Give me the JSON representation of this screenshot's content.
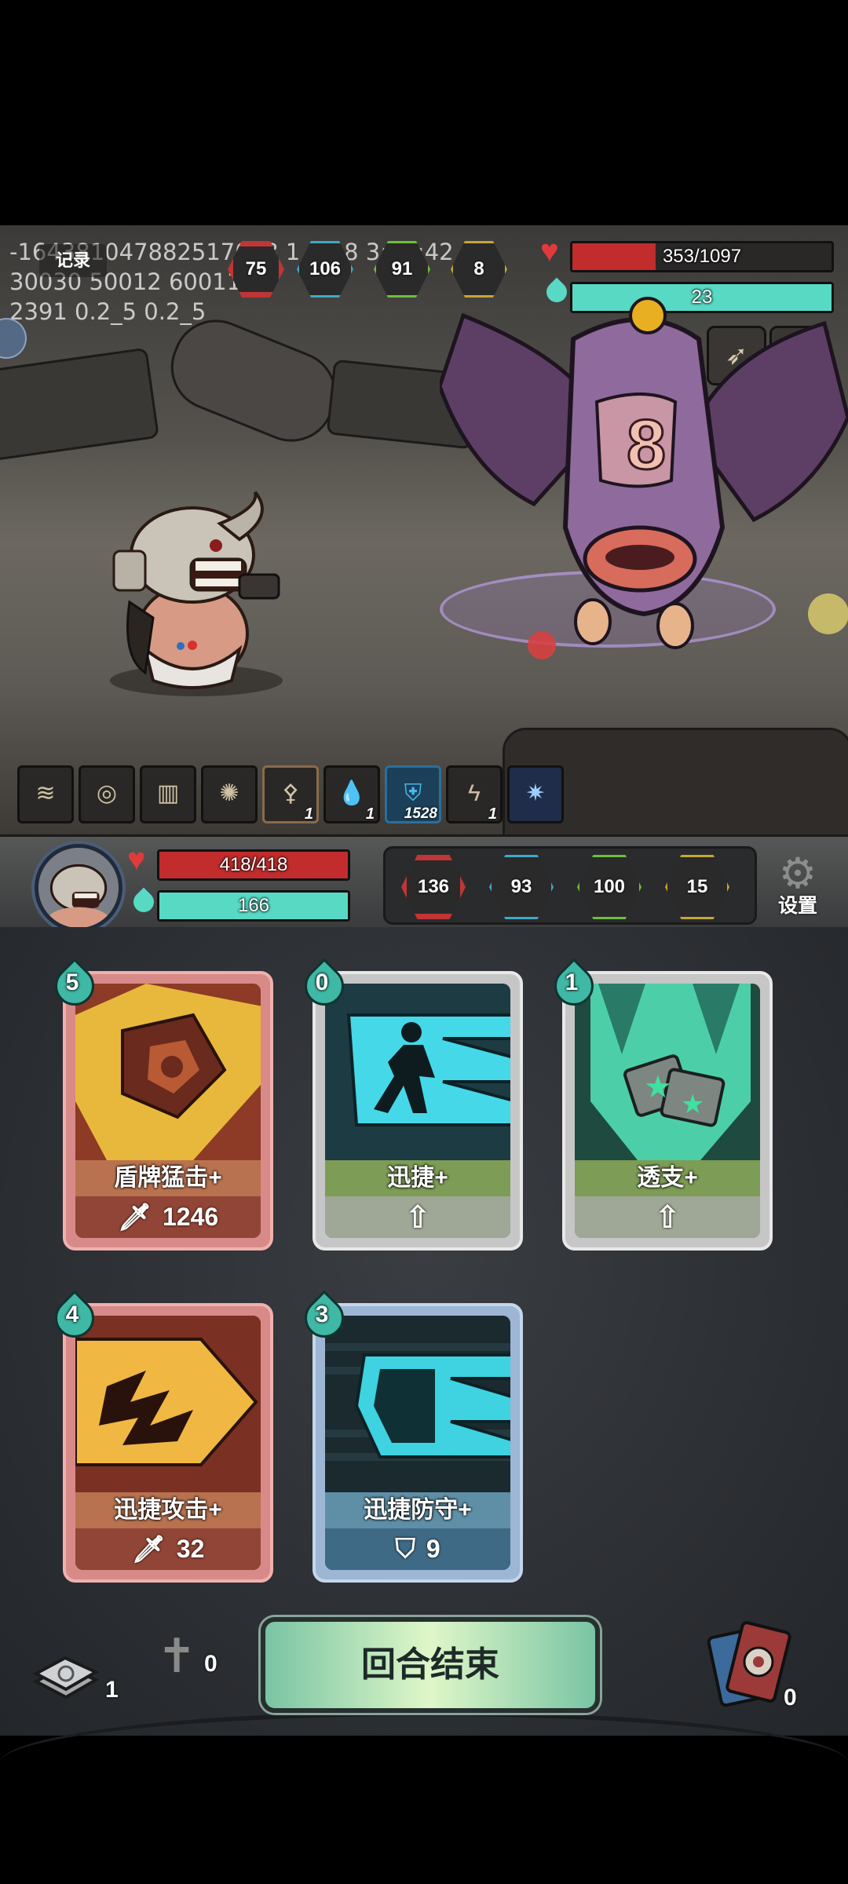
{
  "debug": {
    "line1": "-164381047882517078 1 9/18 3:29:42",
    "line2": "30030 50012 60011",
    "line3": "2391 0.2_5 0.2_5",
    "log_button": "记录"
  },
  "enemy": {
    "stats": [
      {
        "icon": "strength-icon",
        "value": "75",
        "color": "#c03535"
      },
      {
        "icon": "wisdom-icon",
        "value": "106",
        "color": "#3fa9c6"
      },
      {
        "icon": "defense-icon",
        "value": "91",
        "color": "#6cbf3a"
      },
      {
        "icon": "agility-icon",
        "value": "8",
        "color": "#c6a632"
      }
    ],
    "hp": {
      "text": "353/1097",
      "current": 353,
      "max": 1097,
      "color": "#c22c2c"
    },
    "energy": {
      "text": "23",
      "fraction": 1.0,
      "color": "#57d9c4"
    },
    "relics": [
      {
        "icon": "horn-icon"
      },
      {
        "icon": "planet-ring-icon"
      }
    ]
  },
  "statuses": [
    {
      "icon": "mummy-wrap-icon",
      "count": ""
    },
    {
      "icon": "shell-icon",
      "count": ""
    },
    {
      "icon": "wrist-guard-icon",
      "count": ""
    },
    {
      "icon": "compass-icon",
      "count": ""
    },
    {
      "icon": "bone-icon",
      "count": "1"
    },
    {
      "icon": "droplets-icon",
      "count": "1"
    },
    {
      "icon": "block-shield-icon",
      "count": "1528"
    },
    {
      "icon": "lightning-drop-icon",
      "count": "1"
    },
    {
      "icon": "crystal-burst-icon",
      "count": ""
    }
  ],
  "player": {
    "hp": {
      "text": "418/418",
      "current": 418,
      "max": 418,
      "color": "#c22c2c"
    },
    "energy": {
      "text": "166",
      "fraction": 1.0,
      "color": "#57d9c4"
    },
    "stats": [
      {
        "icon": "strength-icon",
        "value": "136",
        "color": "#c03535"
      },
      {
        "icon": "wisdom-icon",
        "value": "93",
        "color": "#3fa9c6"
      },
      {
        "icon": "defense-icon",
        "value": "100",
        "color": "#6cbf3a"
      },
      {
        "icon": "agility-icon",
        "value": "15",
        "color": "#c6a632"
      }
    ],
    "settings_label": "设置"
  },
  "cards": [
    {
      "name": "盾牌猛击+",
      "cost": "5",
      "type": "attack",
      "value_icon": "blade-icon",
      "value": "1246",
      "art": "shield-bash-art"
    },
    {
      "name": "迅捷+",
      "cost": "0",
      "type": "skill",
      "value_icon": "upgrade-arrow-icon",
      "value": "",
      "art": "running-figure-art"
    },
    {
      "name": "透支+",
      "cost": "1",
      "type": "skill",
      "value_icon": "upgrade-arrow-icon",
      "value": "",
      "art": "star-cards-art"
    },
    {
      "name": "迅捷攻击+",
      "cost": "4",
      "type": "attack",
      "value_icon": "blade-icon",
      "value": "32",
      "art": "swift-strike-art"
    },
    {
      "name": "迅捷防守+",
      "cost": "3",
      "type": "power",
      "value_icon": "shield-icon",
      "value": "9",
      "art": "swift-shield-art"
    }
  ],
  "bottom": {
    "draw_pile": "1",
    "graveyard": "0",
    "end_turn": "回合结束",
    "discard_pile": "0"
  }
}
